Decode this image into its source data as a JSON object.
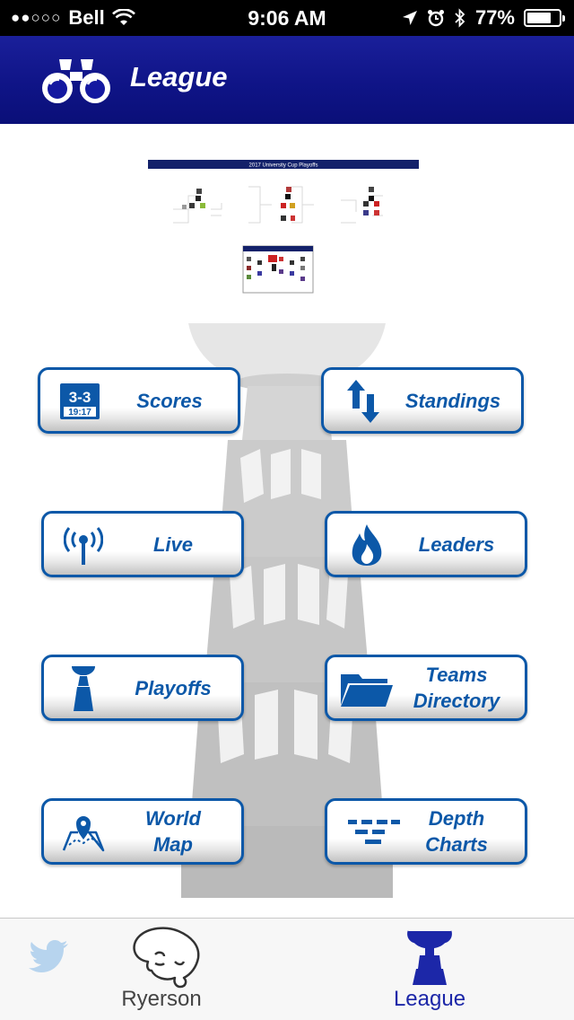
{
  "status_bar": {
    "signal_dots": "●●○○○",
    "carrier": "Bell",
    "time": "9:06 AM",
    "battery_percent": "77%",
    "battery_level": 0.77
  },
  "header": {
    "title": "League",
    "logo_icon": "binoculars-icon"
  },
  "bracket": {
    "title": "2017 University Cup Playoffs"
  },
  "menu": {
    "scores": {
      "label": "Scores",
      "icon": "scoreboard-icon",
      "score": "3-3",
      "clock": "19:17"
    },
    "standings": {
      "label": "Standings",
      "icon": "up-down-arrows-icon"
    },
    "live": {
      "label": "Live",
      "icon": "broadcast-icon"
    },
    "leaders": {
      "label": "Leaders",
      "icon": "flame-icon"
    },
    "playoffs": {
      "label": "Playoffs",
      "icon": "trophy-icon"
    },
    "teams_directory": {
      "label": "Teams\nDirectory",
      "icon": "folder-icon"
    },
    "world_map": {
      "label": "World\nMap",
      "icon": "map-pin-icon"
    },
    "depth_charts": {
      "label": "Depth\nCharts",
      "icon": "depth-chart-icon"
    }
  },
  "tabbar": {
    "twitter_icon": "twitter-bird-icon",
    "ryerson_label": "Ryerson",
    "league_label": "League"
  },
  "colors": {
    "accent": "#0c58a8",
    "header": "#0f1487",
    "active_tab": "#1c27a8",
    "inactive_tab": "#444444"
  }
}
